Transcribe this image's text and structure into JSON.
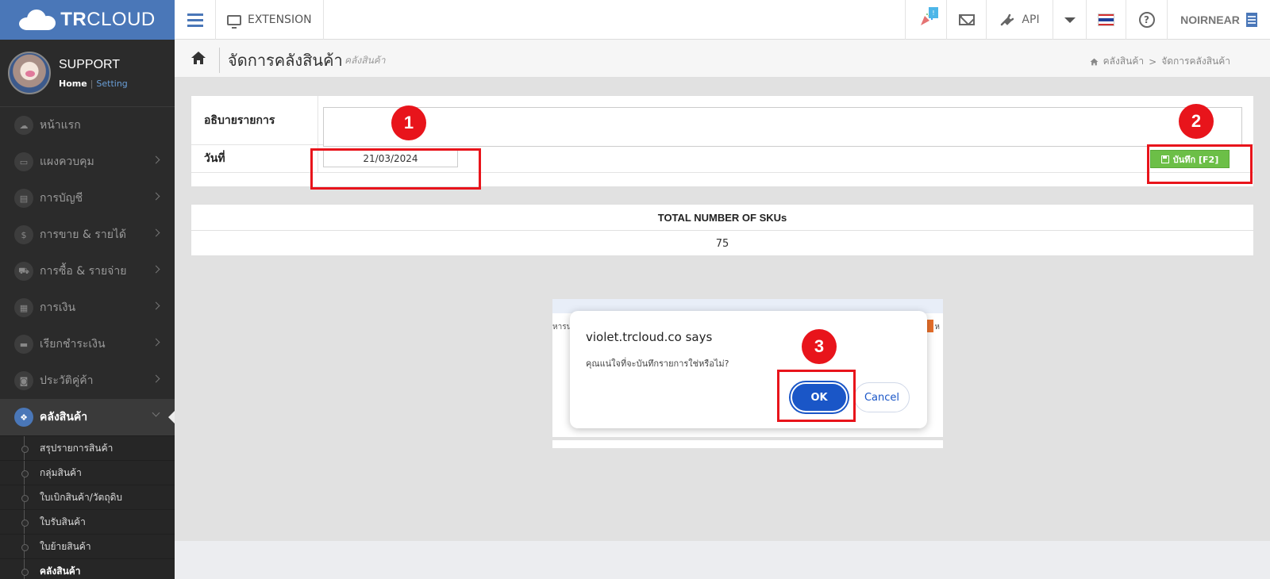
{
  "topbar": {
    "brand_bold": "TR",
    "brand_light": "CLOUD",
    "extension_label": "EXTENSION",
    "notification_badge": "!",
    "api_label": "API",
    "help_glyph": "?",
    "user_name": "NOIRNEAR",
    "flag_colors": [
      "#d32f2f",
      "#ffffff",
      "#1f3f99",
      "#ffffff",
      "#d32f2f"
    ]
  },
  "profile": {
    "name": "SUPPORT",
    "home_link": "Home",
    "setting_link": "Setting"
  },
  "sidebar": {
    "items": [
      {
        "label": "หน้าแรก",
        "icon": "cloud-icon",
        "glyph": "☁",
        "has_children": false
      },
      {
        "label": "แผงควบคุม",
        "icon": "monitor-icon",
        "glyph": "▭",
        "has_children": true
      },
      {
        "label": "การบัญชี",
        "icon": "book-icon",
        "glyph": "▤",
        "has_children": true
      },
      {
        "label": "การขาย & รายได้",
        "icon": "dollar-icon",
        "glyph": "$",
        "has_children": true
      },
      {
        "label": "การซื้อ & รายจ่าย",
        "icon": "cart-icon",
        "glyph": "⛟",
        "has_children": true
      },
      {
        "label": "การเงิน",
        "icon": "calendar-icon",
        "glyph": "▦",
        "has_children": true
      },
      {
        "label": "เรียกชำระเงิน",
        "icon": "credit-card-icon",
        "glyph": "▬",
        "has_children": true
      },
      {
        "label": "ประวัติคู่ค้า",
        "icon": "contact-icon",
        "glyph": "◙",
        "has_children": true
      }
    ],
    "active_item": {
      "label": "คลังสินค้า",
      "icon": "cubes-icon",
      "glyph": "❖"
    },
    "sub_items": [
      "สรุปรายการสินค้า",
      "กลุ่มสินค้า",
      "ใบเบิกสินค้า/วัตถุดิบ",
      "ใบรับสินค้า",
      "ใบย้ายสินค้า",
      "คลังสินค้า"
    ]
  },
  "header": {
    "title": "จัดการคลังสินค้า",
    "subtitle": "คลังสินค้า",
    "breadcrumb": [
      "คลังสินค้า",
      "จัดการคลังสินค้า"
    ],
    "breadcrumb_sep": ">"
  },
  "form": {
    "description_label": "อธิบายรายการ",
    "description_value": "",
    "date_label": "วันที่",
    "date_value": "21/03/2024",
    "save_label": "บันทึก [F2]"
  },
  "sku_table": {
    "header": "TOTAL NUMBER OF SKUs",
    "value": "75"
  },
  "dialog": {
    "title": "violet.trcloud.co says",
    "message": "คุณแน่ใจที่จะบันทึกรายการใช่หรือไม่?",
    "ok_label": "OK",
    "cancel_label": "Cancel",
    "background_text_left": "หารน",
    "background_text_right": "ห"
  },
  "annotations": [
    "1",
    "2",
    "3"
  ],
  "colors": {
    "brand": "#4a77b8",
    "sidebar_bg": "#2b2b2b",
    "save_button": "#6cbf47",
    "dialog_primary": "#1a56c7",
    "annotation_red": "#e8141b"
  }
}
